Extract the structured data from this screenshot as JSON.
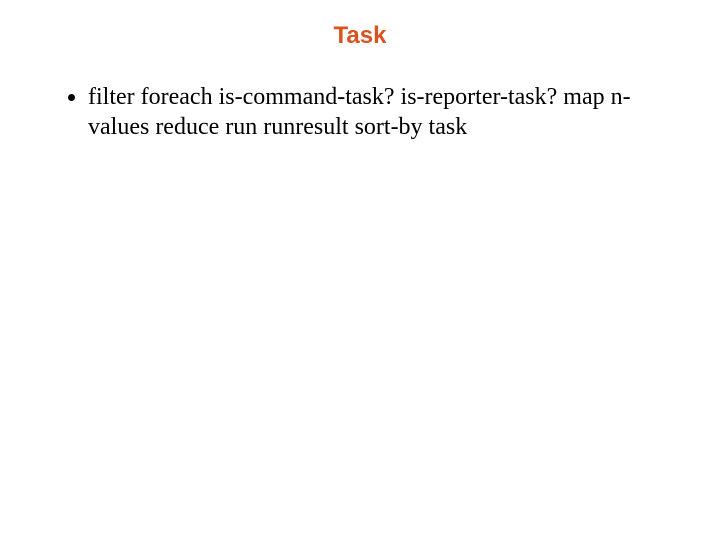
{
  "colors": {
    "title": "#d9531e",
    "text": "#000000",
    "background": "#ffffff"
  },
  "slide": {
    "title": "Task",
    "bullets": [
      "filter foreach is-command-task? is-reporter-task? map n-values reduce run runresult sort-by task"
    ]
  }
}
